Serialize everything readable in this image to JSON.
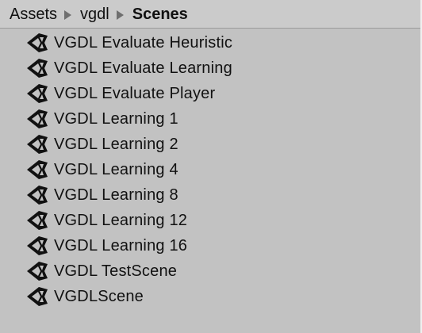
{
  "breadcrumb": {
    "items": [
      {
        "label": "Assets"
      },
      {
        "label": "vgdl"
      },
      {
        "label": "Scenes"
      }
    ]
  },
  "scenes": {
    "icon": "unity-scene-icon",
    "items": [
      {
        "label": "VGDL Evaluate Heuristic"
      },
      {
        "label": "VGDL Evaluate Learning"
      },
      {
        "label": "VGDL Evaluate Player"
      },
      {
        "label": "VGDL Learning 1"
      },
      {
        "label": "VGDL Learning 2"
      },
      {
        "label": "VGDL Learning 4"
      },
      {
        "label": "VGDL Learning 8"
      },
      {
        "label": "VGDL Learning 12"
      },
      {
        "label": "VGDL Learning 16"
      },
      {
        "label": "VGDL TestScene"
      },
      {
        "label": "VGDLScene"
      }
    ]
  },
  "colors": {
    "background": "#c2c2c2",
    "breadcrumb_bar": "#cbcbcb",
    "text": "#111111",
    "separator_arrow": "#6f6f6f"
  }
}
